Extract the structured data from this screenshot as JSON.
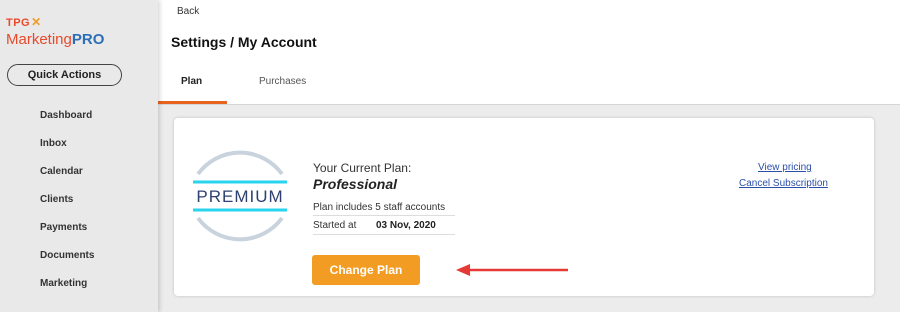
{
  "logo": {
    "tpg": "TPG",
    "marketing": "Marketing",
    "pro": "PRO"
  },
  "sidebar": {
    "quick_actions": "Quick Actions",
    "items": [
      "Dashboard",
      "Inbox",
      "Calendar",
      "Clients",
      "Payments",
      "Documents",
      "Marketing"
    ]
  },
  "header": {
    "back": "Back",
    "title": "Settings / My Account"
  },
  "tabs": [
    {
      "label": "Plan",
      "active": true
    },
    {
      "label": "Purchases",
      "active": false
    }
  ],
  "plan": {
    "badge_text": "PREMIUM",
    "current_label": "Your Current Plan:",
    "name": "Professional",
    "staff": "Plan includes 5 staff accounts",
    "started_label": "Started at",
    "started_value": "03 Nov, 2020",
    "change_button": "Change Plan",
    "view_pricing": "View pricing",
    "cancel_subscription": "Cancel Subscription"
  },
  "colors": {
    "brand_orange": "#f39c23",
    "brand_red": "#e8492b",
    "brand_blue": "#2c6fb6",
    "link": "#2a4fa8",
    "arrow": "#e53935",
    "badge_cyan": "#29d3ee"
  }
}
